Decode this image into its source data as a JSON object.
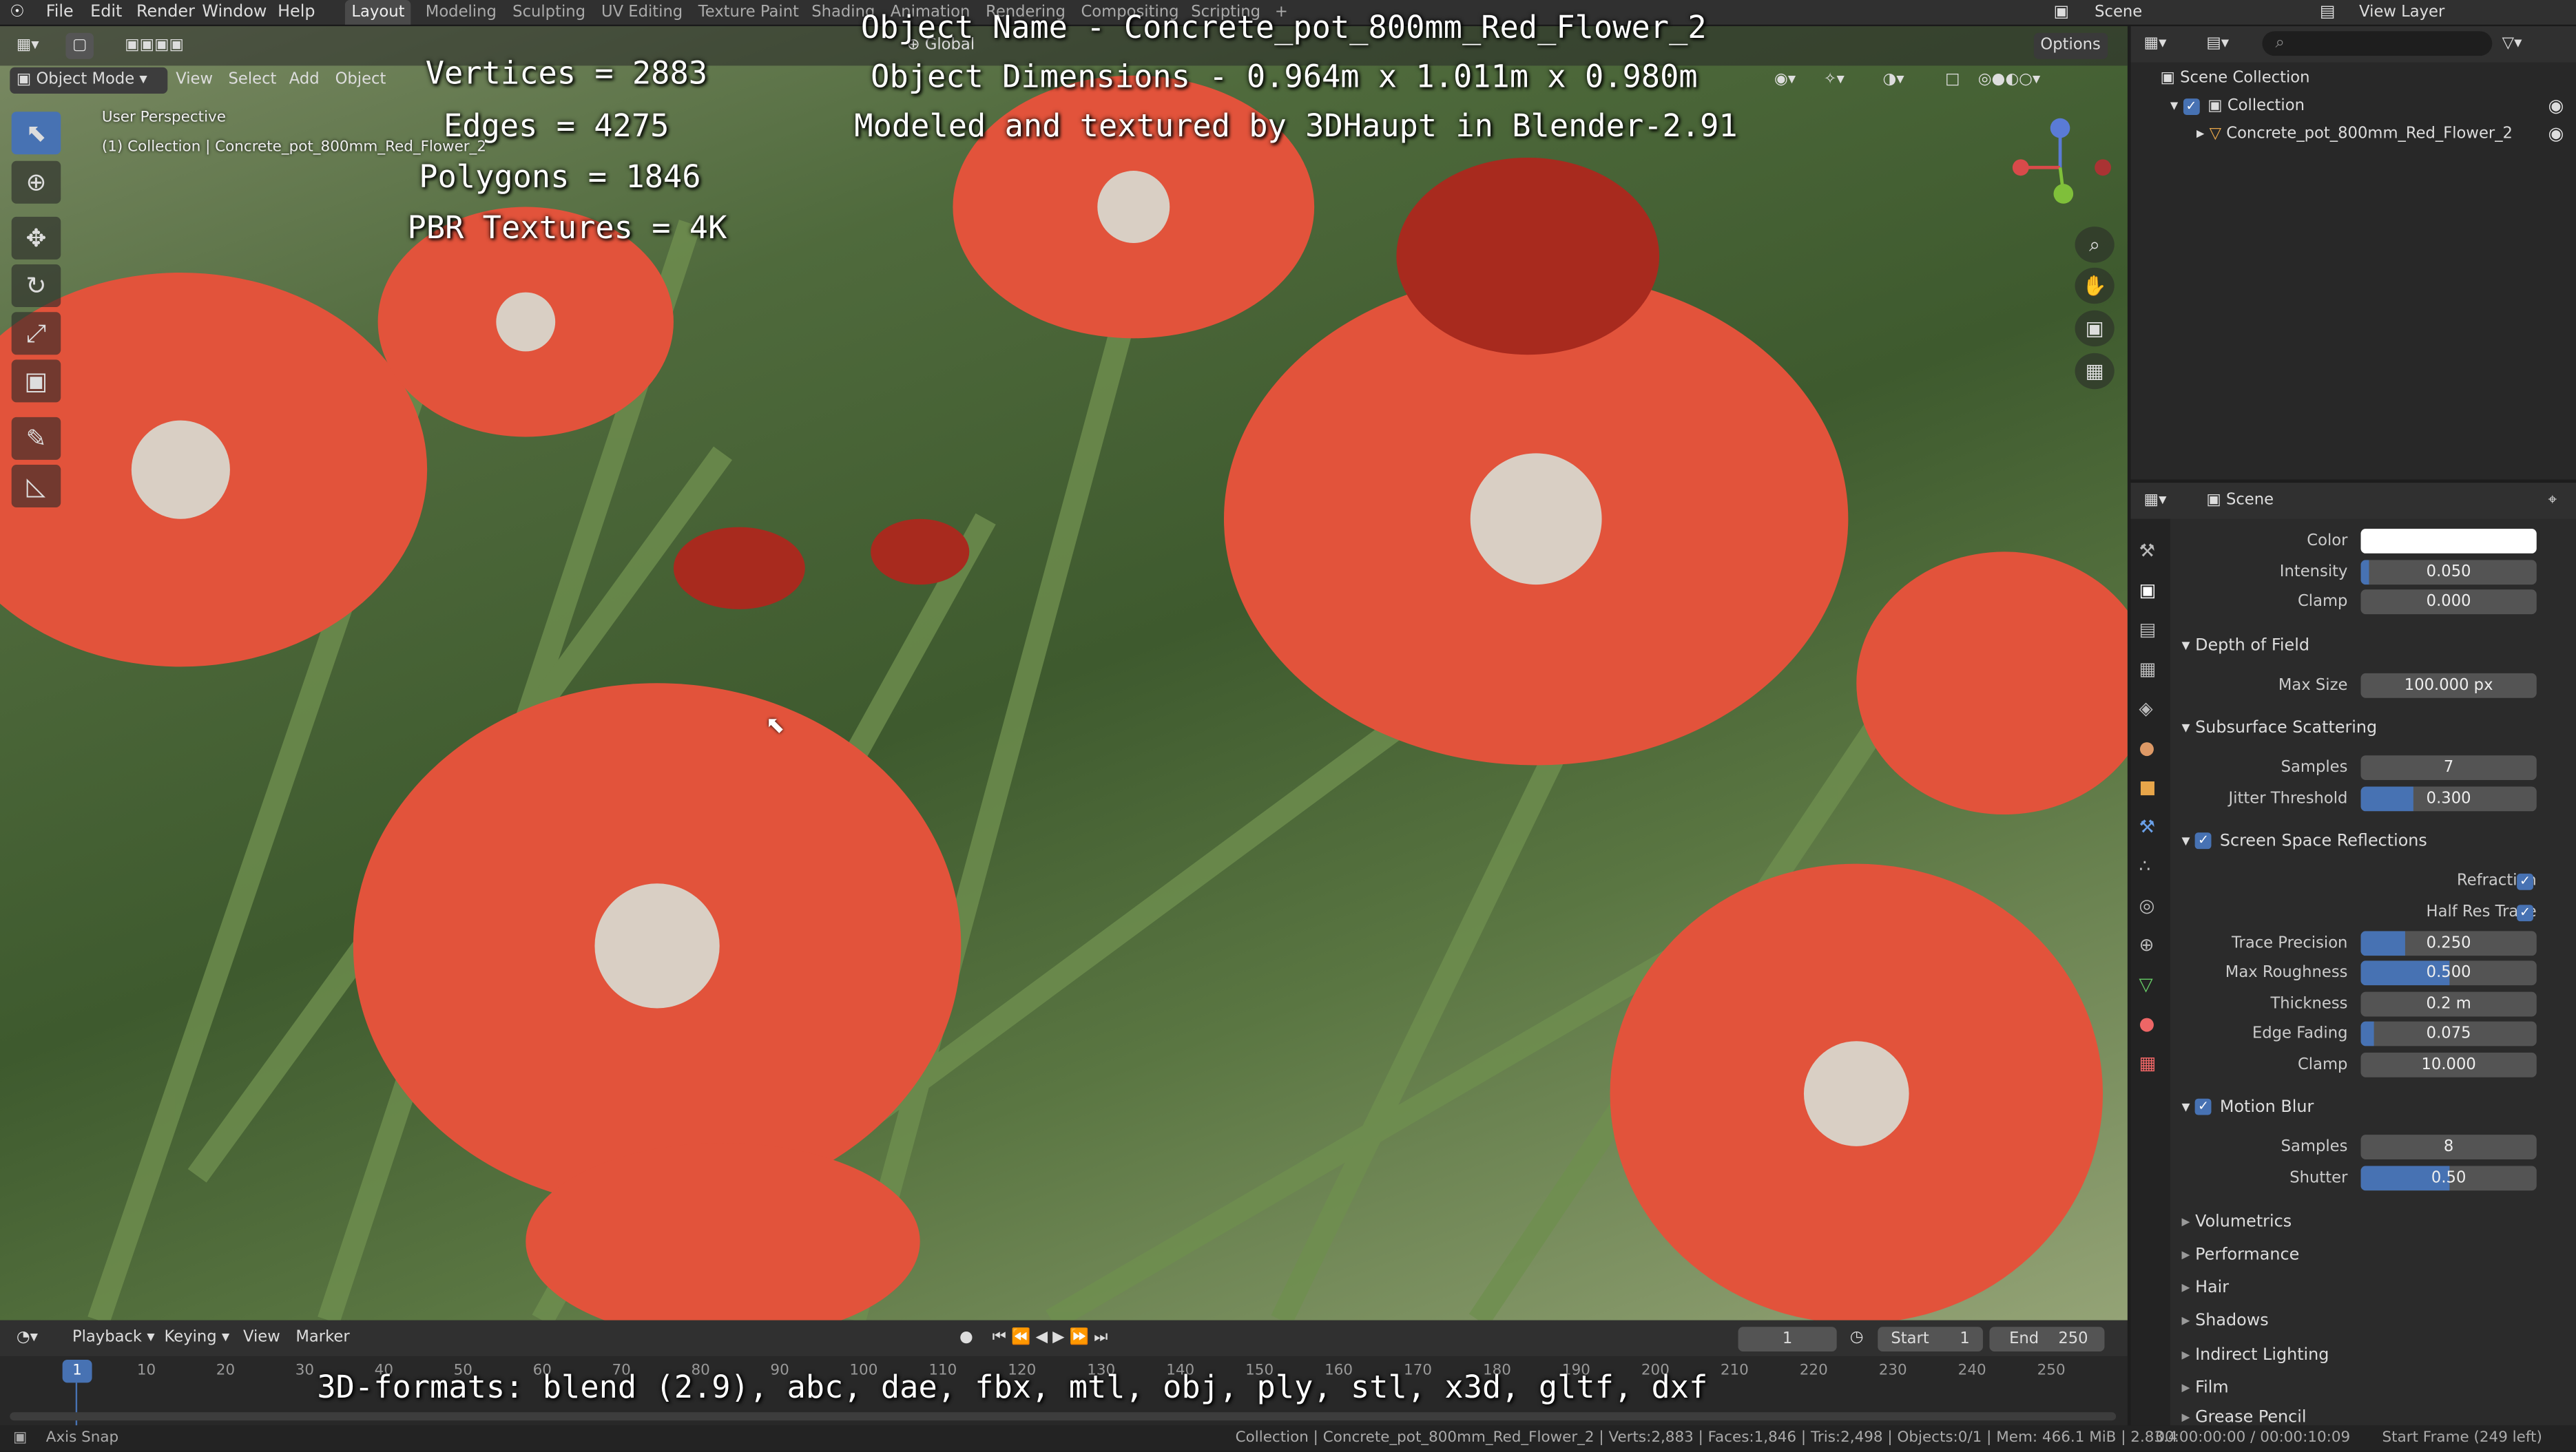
{
  "topbar": {
    "menus": [
      "File",
      "Edit",
      "Render",
      "Window",
      "Help"
    ],
    "workspaces": [
      "Layout",
      "Modeling",
      "Sculpting",
      "UV Editing",
      "Texture Paint",
      "Shading",
      "Animation",
      "Rendering",
      "Compositing",
      "Scripting"
    ],
    "active_workspace": "Layout",
    "scene": "Scene",
    "view_layer": "View Layer"
  },
  "viewport": {
    "mode": "Object Mode",
    "menus": [
      "View",
      "Select",
      "Add",
      "Object"
    ],
    "orientation": "Global",
    "options": "Options",
    "view_name": "User Perspective",
    "view_collection": "(1) Collection | Concrete_pot_800mm_Red_Flower_2"
  },
  "overlay": {
    "stats": [
      "Vertices = 2883",
      "Edges = 4275",
      "Polygons = 1846",
      "PBR Textures = 4K"
    ],
    "info": [
      "Object Name - Concrete_pot_800mm_Red_Flower_2",
      "Object Dimensions - 0.964m x 1.011m x 0.980m",
      "Modeled and textured by 3DHaupt in Blender-2.91"
    ],
    "formats": "3D-formats: blend (2.9), abc, dae, fbx, mtl, obj, ply, stl, x3d, gltf, dxf"
  },
  "outliner": {
    "root": "Scene Collection",
    "collection": "Collection",
    "object": "Concrete_pot_800mm_Red_Flower_2"
  },
  "properties": {
    "context": "Scene",
    "rows": [
      {
        "label": "Color",
        "value": "",
        "type": "color"
      },
      {
        "label": "Intensity",
        "value": "0.050",
        "fill": 0.05
      },
      {
        "label": "Clamp",
        "value": "0.000"
      }
    ],
    "dof": {
      "title": "Depth of Field",
      "rows": [
        {
          "label": "Max Size",
          "value": "100.000 px"
        }
      ]
    },
    "sss": {
      "title": "Subsurface Scattering",
      "rows": [
        {
          "label": "Samples",
          "value": "7"
        },
        {
          "label": "Jitter Threshold",
          "value": "0.300",
          "fill": 0.3
        }
      ]
    },
    "ssr": {
      "title": "Screen Space Reflections",
      "checks": [
        {
          "label": "Refraction"
        },
        {
          "label": "Half Res Trace"
        }
      ],
      "rows": [
        {
          "label": "Trace Precision",
          "value": "0.250",
          "fill": 0.25
        },
        {
          "label": "Max Roughness",
          "value": "0.500",
          "fill": 0.5
        },
        {
          "label": "Thickness",
          "value": "0.2 m"
        },
        {
          "label": "Edge Fading",
          "value": "0.075",
          "fill": 0.075
        },
        {
          "label": "Clamp",
          "value": "10.000"
        }
      ]
    },
    "mb": {
      "title": "Motion Blur",
      "rows": [
        {
          "label": "Samples",
          "value": "8"
        },
        {
          "label": "Shutter",
          "value": "0.50",
          "fill": 0.5
        }
      ]
    },
    "collapsed": [
      "Volumetrics",
      "Performance",
      "Hair",
      "Shadows",
      "Indirect Lighting",
      "Film",
      "Grease Pencil"
    ]
  },
  "timeline": {
    "menus": [
      "Playback",
      "Keying",
      "View",
      "Marker"
    ],
    "current_frame": "1",
    "start_label": "Start",
    "start": "1",
    "end_label": "End",
    "end": "250",
    "ticks": [
      "1",
      "10",
      "20",
      "30",
      "40",
      "50",
      "60",
      "70",
      "80",
      "90",
      "100",
      "110",
      "120",
      "130",
      "140",
      "150",
      "160",
      "170",
      "180",
      "190",
      "200",
      "210",
      "220",
      "230",
      "240",
      "250"
    ]
  },
  "statusbar": {
    "left": "Axis Snap",
    "center": "Collection | Concrete_pot_800mm_Red_Flower_2 | Verts:2,883 | Faces:1,846 | Tris:2,498 | Objects:0/1 | Mem: 466.1 MiB | 2.83.4",
    "right": "00:00:00:00 / 00:00:10:09",
    "far_right": "Start Frame (249 left)"
  },
  "colors": {
    "accent": "#4772b3",
    "flower": "#e8503a",
    "leaf": "#4f6a3c"
  }
}
